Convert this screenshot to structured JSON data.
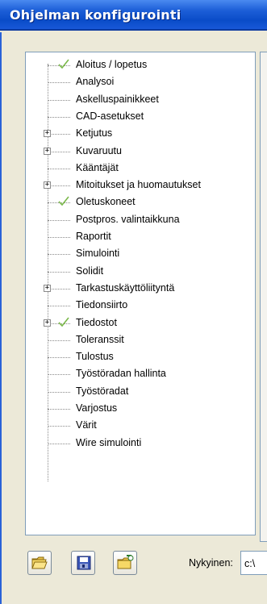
{
  "window": {
    "title": "Ohjelman konfigurointi"
  },
  "tree": {
    "items": [
      {
        "label": "Aloitus / lopetus",
        "expandable": false,
        "checked": true
      },
      {
        "label": "Analysoi",
        "expandable": false,
        "checked": false
      },
      {
        "label": "Askelluspainikkeet",
        "expandable": false,
        "checked": false
      },
      {
        "label": "CAD-asetukset",
        "expandable": false,
        "checked": false
      },
      {
        "label": "Ketjutus",
        "expandable": true,
        "checked": false
      },
      {
        "label": "Kuvaruutu",
        "expandable": true,
        "checked": false
      },
      {
        "label": "Kääntäjät",
        "expandable": false,
        "checked": false
      },
      {
        "label": "Mitoitukset ja huomautukset",
        "expandable": true,
        "checked": false
      },
      {
        "label": "Oletuskoneet",
        "expandable": false,
        "checked": true
      },
      {
        "label": "Postpros. valintaikkuna",
        "expandable": false,
        "checked": false
      },
      {
        "label": "Raportit",
        "expandable": false,
        "checked": false
      },
      {
        "label": "Simulointi",
        "expandable": false,
        "checked": false
      },
      {
        "label": "Solidit",
        "expandable": false,
        "checked": false
      },
      {
        "label": "Tarkastuskäyttöliityntä",
        "expandable": true,
        "checked": false
      },
      {
        "label": "Tiedonsiirto",
        "expandable": false,
        "checked": false
      },
      {
        "label": "Tiedostot",
        "expandable": true,
        "checked": true
      },
      {
        "label": "Toleranssit",
        "expandable": false,
        "checked": false
      },
      {
        "label": "Tulostus",
        "expandable": false,
        "checked": false
      },
      {
        "label": "Työstöradan hallinta",
        "expandable": false,
        "checked": false
      },
      {
        "label": "Työstöradat",
        "expandable": false,
        "checked": false
      },
      {
        "label": "Varjostus",
        "expandable": false,
        "checked": false
      },
      {
        "label": "Värit",
        "expandable": false,
        "checked": false
      },
      {
        "label": "Wire simulointi",
        "expandable": false,
        "checked": false
      }
    ]
  },
  "bottom": {
    "buttons": [
      "open-folder-icon",
      "save-disk-icon",
      "folder-new-icon"
    ],
    "current_label": "Nykyinen:",
    "current_value": "c:\\"
  },
  "colors": {
    "title_bar": "#0a4cc8",
    "check_mark": "#7ab84a",
    "panel_bg": "#ece9d8"
  }
}
